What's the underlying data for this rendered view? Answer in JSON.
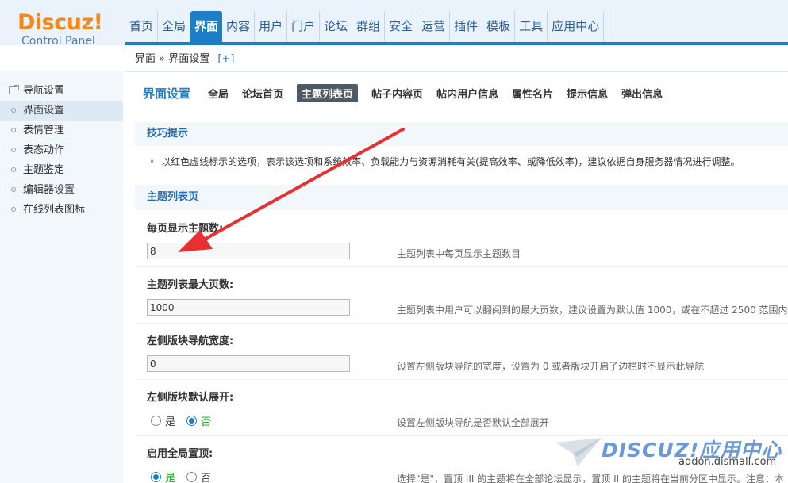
{
  "header": {
    "logo_main": "Discuz!",
    "logo_sub": "Control Panel",
    "nav": [
      {
        "label": "首页"
      },
      {
        "label": "全局"
      },
      {
        "label": "界面",
        "active": true
      },
      {
        "label": "内容"
      },
      {
        "label": "用户"
      },
      {
        "label": "门户"
      },
      {
        "label": "论坛"
      },
      {
        "label": "群组"
      },
      {
        "label": "安全"
      },
      {
        "label": "运营"
      },
      {
        "label": "插件"
      },
      {
        "label": "模板"
      },
      {
        "label": "工具"
      },
      {
        "label": "应用中心"
      }
    ]
  },
  "breadcrumb": {
    "path": "界面 » 界面设置",
    "plus": "[+]"
  },
  "sidebar": {
    "items": [
      {
        "label": "导航设置"
      },
      {
        "label": "界面设置",
        "active": true
      },
      {
        "label": "表情管理"
      },
      {
        "label": "表态动作"
      },
      {
        "label": "主题鉴定"
      },
      {
        "label": "编辑器设置"
      },
      {
        "label": "在线列表图标"
      }
    ]
  },
  "main": {
    "title": "界面设置",
    "tabs": [
      {
        "label": "全局"
      },
      {
        "label": "论坛首页"
      },
      {
        "label": "主题列表页",
        "active": true
      },
      {
        "label": "帖子内容页"
      },
      {
        "label": "帖内用户信息"
      },
      {
        "label": "属性名片"
      },
      {
        "label": "提示信息"
      },
      {
        "label": "弹出信息"
      }
    ],
    "tips_title": "技巧提示",
    "tips_text": "以红色虚线标示的选项，表示该选项和系统效率、负载能力与资源消耗有关(提高效率、或降低效率)，建议依据自身服务器情况进行调整。",
    "list_title": "主题列表页",
    "settings": [
      {
        "label": "每页显示主题数:",
        "value": "8",
        "desc": "主题列表中每页显示主题数目"
      },
      {
        "label": "主题列表最大页数:",
        "value": "1000",
        "desc": "主题列表中用户可以翻阅到的最大页数，建议设置为默认值 1000，或在不超过 2500 范围内"
      },
      {
        "label": "左侧版块导航宽度:",
        "value": "0",
        "desc": "设置左侧版块导航的宽度，设置为 0 或者版块开启了边栏时不显示此导航"
      }
    ],
    "radio_settings": [
      {
        "label": "左侧版块默认展开:",
        "yes": "是",
        "no": "否",
        "selected": "否",
        "desc": "设置左侧版块导航是否默认全部展开"
      },
      {
        "label": "启用全局置顶:",
        "yes": "是",
        "no": "否",
        "selected": "是",
        "desc": "选择\"是\"，置顶 III 的主题将在全部论坛显示，置顶 II 的主题将在当前分区中显示。注意：本"
      }
    ]
  },
  "watermark": {
    "brand": "DISCUZ!应用中心",
    "url": "addon.dismall.com"
  },
  "colors": {
    "accent": "#1c7ec7",
    "logo": "#f08a1a",
    "arrow": "#e83030"
  }
}
